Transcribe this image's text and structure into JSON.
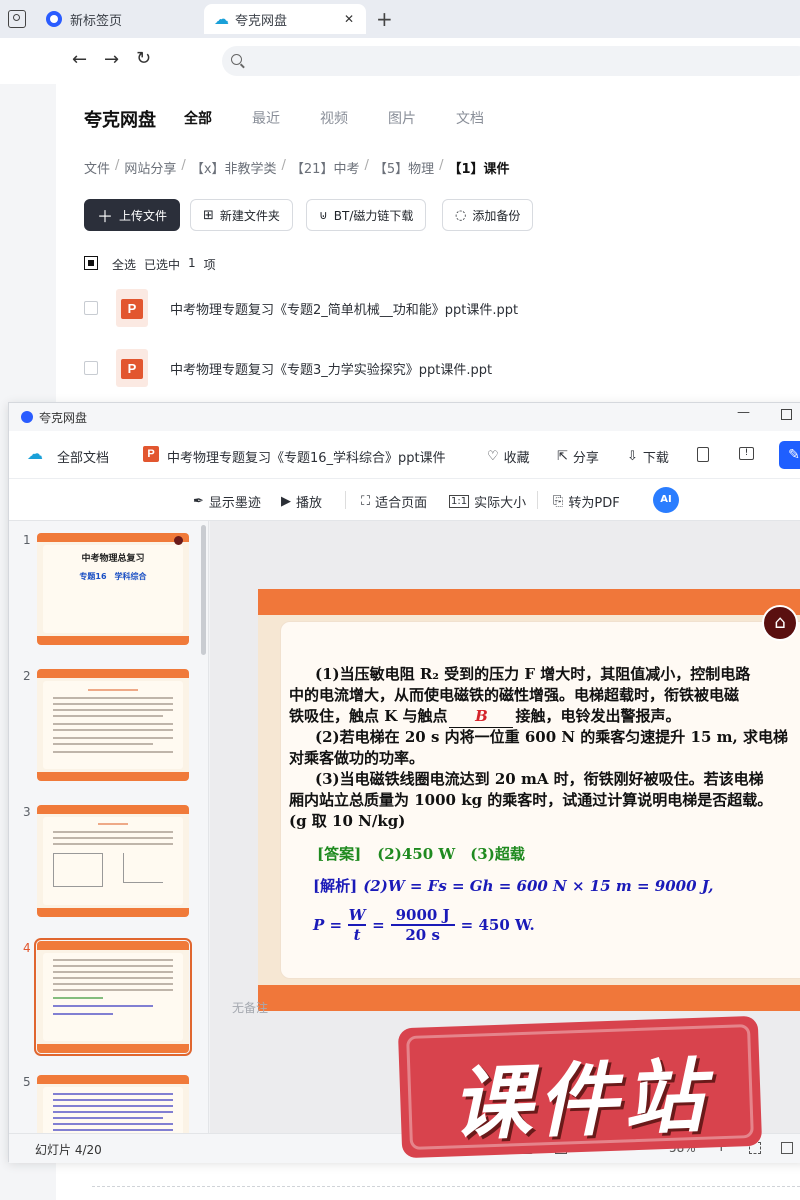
{
  "browser": {
    "tabs": [
      {
        "label": "新标签页"
      },
      {
        "label": "夸克网盘"
      }
    ],
    "new_tab_symbol": "+",
    "close_symbol": "✕"
  },
  "pan": {
    "brand": "夸克网盘",
    "nav": [
      "全部",
      "最近",
      "视频",
      "图片",
      "文档"
    ],
    "breadcrumb": [
      "文件",
      "/",
      "网站分享",
      "/",
      "【x】非教学类",
      "/",
      "【21】中考",
      "/",
      "【5】物理",
      "/",
      "【1】课件"
    ],
    "buttons": {
      "upload": "上传文件",
      "new_folder": "新建文件夹",
      "bt": "BT/磁力链下载",
      "backup": "添加备份"
    },
    "select_all": "全选",
    "selected_prefix": "已选中",
    "selected_count": "1",
    "selected_suffix": "项",
    "files": [
      {
        "name": "中考物理专题复习《专题2_简单机械__功和能》ppt课件.ppt"
      },
      {
        "name": "中考物理专题复习《专题3_力学实验探究》ppt课件.ppt"
      }
    ]
  },
  "viewer": {
    "window_title": "夸克网盘",
    "all_docs": "全部文档",
    "doc_title": "中考物理专题复习《专题16_学科综合》ppt课件",
    "actions": {
      "favorite": "收藏",
      "share": "分享",
      "download": "下载"
    },
    "toolbar": {
      "ink": "显示墨迹",
      "play": "播放",
      "fit": "适合页面",
      "actual": "实际大小",
      "pdf": "转为PDF",
      "ai": "AI"
    },
    "thumbnails": [
      {
        "num": "1",
        "title": "中考物理总复习",
        "subtitle": "专题16　学科综合"
      },
      {
        "num": "2"
      },
      {
        "num": "3"
      },
      {
        "num": "4"
      },
      {
        "num": "5"
      }
    ],
    "current_index": 4,
    "notes_placeholder": "无备注",
    "status": "幻灯片 4/20",
    "zoom": "58%",
    "zoom_minus": "−",
    "zoom_plus": "+"
  },
  "slide": {
    "p1a": "(1)当压敏电阻 R₂ 受到的压力 F 增大时，其阻值减小，控制电路",
    "p1b": "中的电流增大，从而使电磁铁的磁性增强。电梯超载时，衔铁被电磁",
    "p1c_before": "铁吸住，触点 K 与触点",
    "p1c_answer": "B",
    "p1c_after": "接触，电铃发出警报声。",
    "p2a": "(2)若电梯在 20 s 内将一位重 600 N 的乘客匀速提升 15 m, 求电梯",
    "p2b": "对乘客做功的功率。",
    "p3a": "(3)当电磁铁线圈电流达到 20 mA 时，衔铁刚好被吸住。若该电梯",
    "p3b": "厢内站立总质量为 1000 kg 的乘客时，试通过计算说明电梯是否超载。",
    "p3c": "(g 取 10 N/kg)",
    "answer_label": "[答案]",
    "answer": "(2)450 W　(3)超载",
    "analysis_label": "[解析]",
    "analysis": "(2)W = Fs = Gh = 600 N × 15 m = 9000 J,",
    "formula_p": "P =",
    "formula_w": "W",
    "formula_t": "t",
    "formula_eq": "=",
    "formula_num": "9000 J",
    "formula_den": "20 s",
    "formula_result": "= 450 W."
  },
  "watermark": "课件站",
  "colors": {
    "accent": "#1f5fff",
    "slide_band": "#f0773a",
    "answer_green": "#1f8a1f",
    "analysis_blue": "#1a1ab8",
    "watermark_red": "#d8434d"
  }
}
